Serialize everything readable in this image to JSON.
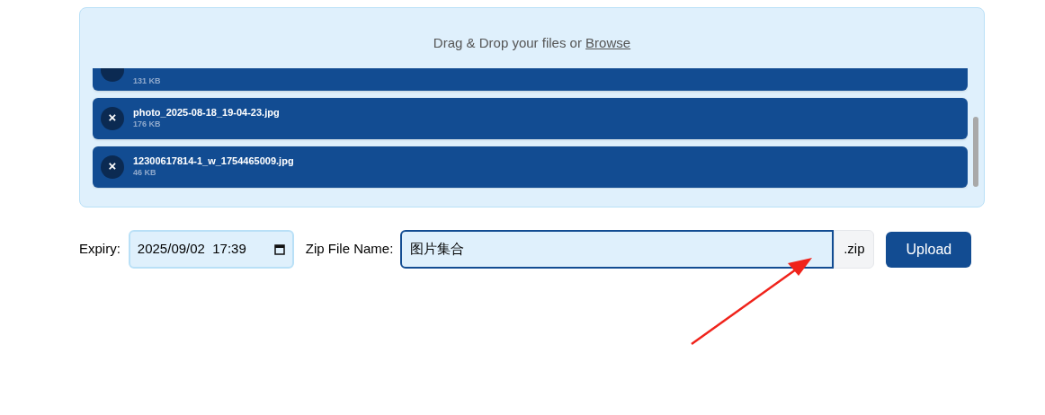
{
  "dropzone": {
    "text": "Drag & Drop your files or ",
    "link": "Browse"
  },
  "files": [
    {
      "size": "131 KB"
    },
    {
      "name": "photo_2025-08-18_19-04-23.jpg",
      "size": "176 KB",
      "remove": "×"
    },
    {
      "name": "12300617814-1_w_1754465009.jpg",
      "size": "46 KB",
      "remove": "×"
    }
  ],
  "expiry": {
    "label": "Expiry:",
    "value": "2025/09/02  17:39"
  },
  "zip_name": {
    "label": "Zip File Name:",
    "value": "图片集合",
    "suffix": ".zip"
  },
  "upload_button": "Upload"
}
